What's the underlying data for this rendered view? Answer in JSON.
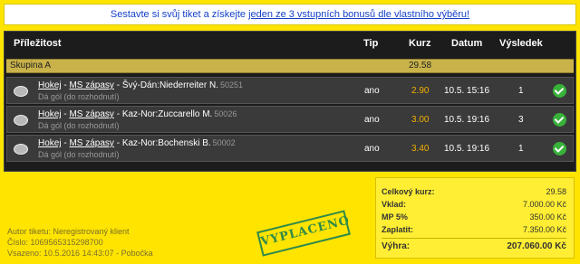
{
  "banner": {
    "text_before": "Sestavte si svůj tiket a získejte",
    "link": "jeden ze 3 vstupních bonusů dle vlastního výběru!"
  },
  "table": {
    "headers": {
      "event": "Příležitost",
      "tip": "Tip",
      "odds": "Kurz",
      "date": "Datum",
      "result": "Výsledek"
    },
    "group": {
      "name": "Skupina A",
      "odds": "29.58"
    },
    "rows": [
      {
        "sport": "Hokej",
        "league": "MS zápasy",
        "match": "Švý-Dán:Niederreiter N.",
        "id": "50251",
        "market": "Dá gól (do rozhodnutí)",
        "tip": "ano",
        "odds": "2.90",
        "date": "10.5. 15:16",
        "result": "1",
        "status_icon": "check-icon"
      },
      {
        "sport": "Hokej",
        "league": "MS zápasy",
        "match": "Kaz-Nor:Zuccarello M.",
        "id": "50026",
        "market": "Dá gól (do rozhodnutí)",
        "tip": "ano",
        "odds": "3.00",
        "date": "10.5. 19:16",
        "result": "3",
        "status_icon": "check-icon"
      },
      {
        "sport": "Hokej",
        "league": "MS zápasy",
        "match": "Kaz-Nor:Bochenski B.",
        "id": "50002",
        "market": "Dá gól (do rozhodnutí)",
        "tip": "ano",
        "odds": "3.40",
        "date": "10.5. 19:16",
        "result": "1",
        "status_icon": "check-icon"
      }
    ]
  },
  "ticket_info": {
    "author": "Autor tiketu: Neregistrovaný klient",
    "number": "Číslo: 1069565315298700",
    "placed": "Vsazeno: 10.5.2016 14:43:07 - Pobočka"
  },
  "stamp": "VYPLACENO",
  "summary": {
    "total_odds_label": "Celkový kurz:",
    "total_odds": "29.58",
    "stake_label": "Vklad:",
    "stake": "7.000.00 Kč",
    "mp_label": "MP 5%",
    "mp": "350.00 Kč",
    "pay_label": "Zaplatit:",
    "pay": "7.350.00 Kč",
    "win_label": "Výhra:",
    "win": "207.060.00 Kč"
  },
  "colors": {
    "background": "#ffe400",
    "odds": "#f2b000",
    "check": "#38b23a",
    "stamp": "#2f8a4a"
  }
}
